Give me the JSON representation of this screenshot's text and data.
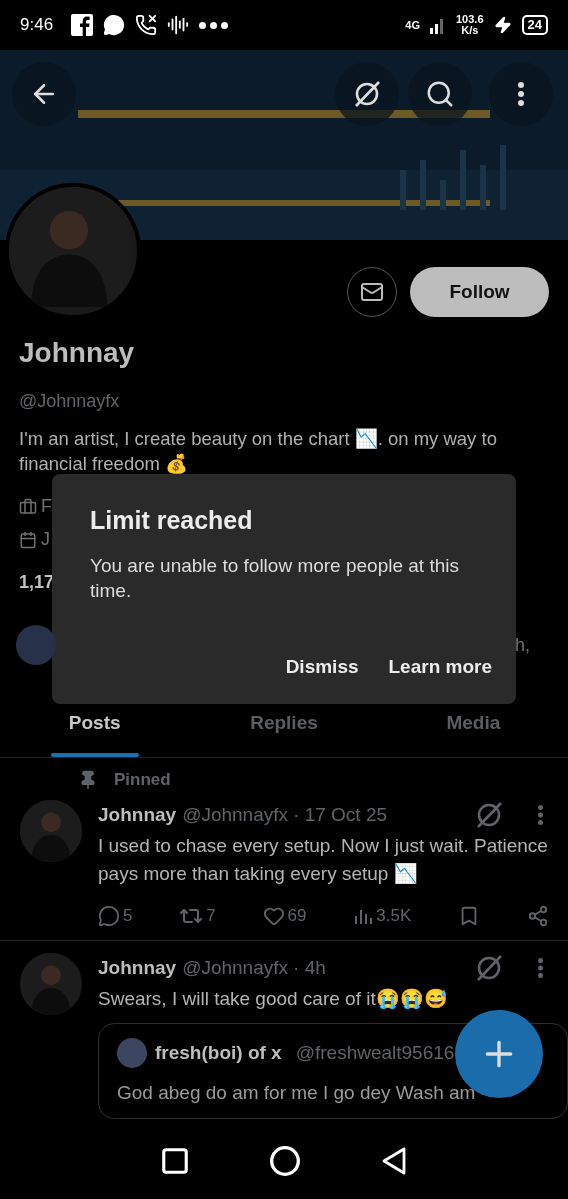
{
  "status_bar": {
    "time": "9:46",
    "network": "4G",
    "speed": "103.6",
    "speed_unit": "K/s",
    "battery": "24"
  },
  "profile": {
    "name": "Johnnay",
    "handle": "@Johnnayfx",
    "bio": "I'm an artist,  I create beauty on the chart 📉. on my way to financial freedom 💰",
    "follow_button": "Follow",
    "details": [
      {
        "kind": "work",
        "text": "F"
      },
      {
        "kind": "joined",
        "text": "J"
      }
    ],
    "stats": "1,17",
    "followed_by": "h,"
  },
  "dialog": {
    "title": "Limit reached",
    "message": "You are unable to follow more people at this time.",
    "actions": [
      "Dismiss",
      "Learn more"
    ]
  },
  "tabs": [
    {
      "label": "Posts",
      "selected": true
    },
    {
      "label": "Replies",
      "selected": false
    },
    {
      "label": "Media",
      "selected": false
    }
  ],
  "posts": [
    {
      "pinned_label": "Pinned",
      "name": "Johnnay",
      "handle": "@Johnnayfx",
      "time": "· 17 Oct 25",
      "text": "I used to chase every setup. Now I just wait. Patience pays more than taking every setup 📉",
      "replies": "5",
      "reposts": "7",
      "likes": "69",
      "views": "3.5K"
    },
    {
      "name": "Johnnay",
      "handle": "@Johnnayfx",
      "time": "· 4h",
      "text": "Swears, I will take good care of it😭😭😅",
      "quote": {
        "name": "fresh(boi) of x",
        "handle": "@freshwealt95616",
        "text": "God abeg do am for me I go dey Wash am"
      }
    }
  ]
}
